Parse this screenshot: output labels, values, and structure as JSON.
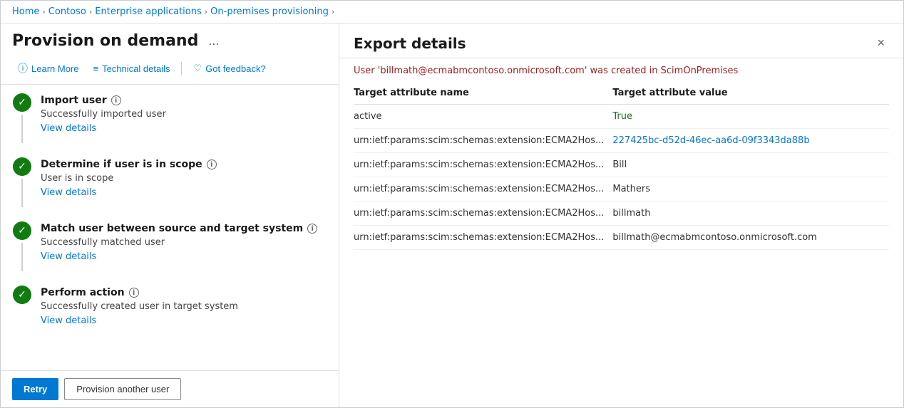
{
  "breadcrumb": {
    "items": [
      {
        "label": "Home",
        "active": true
      },
      {
        "label": "Contoso",
        "active": true
      },
      {
        "label": "Enterprise applications",
        "active": true
      },
      {
        "label": "On-premises provisioning",
        "active": true
      }
    ]
  },
  "left": {
    "title": "Provision on demand",
    "ellipsis": "...",
    "toolbar": {
      "learn_more": "Learn More",
      "technical_details": "Technical details",
      "got_feedback": "Got feedback?"
    },
    "steps": [
      {
        "title": "Import user",
        "desc": "Successfully imported user",
        "link": "View details"
      },
      {
        "title": "Determine if user is in scope",
        "desc": "User is in scope",
        "link": "View details"
      },
      {
        "title": "Match user between source and target system",
        "desc": "Successfully matched user",
        "link": "View details"
      },
      {
        "title": "Perform action",
        "desc": "Successfully created user in target system",
        "link": "View details"
      }
    ],
    "actions": {
      "retry": "Retry",
      "provision_another": "Provision another user"
    }
  },
  "right": {
    "title": "Export details",
    "close_label": "×",
    "subtitle_before": "User '",
    "subtitle_email": "billmath@ecmabmcontoso.onmicrosoft.com",
    "subtitle_after": "' was created in ScimOnPremises",
    "table": {
      "col1": "Target attribute name",
      "col2": "Target attribute value",
      "rows": [
        {
          "attr": "active",
          "value": "True",
          "type": "bool"
        },
        {
          "attr": "urn:ietf:params:scim:schemas:extension:ECMA2Hos...",
          "value": "227425bc-d52d-46ec-aa6d-09f3343da88b",
          "type": "hash"
        },
        {
          "attr": "urn:ietf:params:scim:schemas:extension:ECMA2Hos...",
          "value": "Bill",
          "type": "text"
        },
        {
          "attr": "urn:ietf:params:scim:schemas:extension:ECMA2Hos...",
          "value": "Mathers",
          "type": "text"
        },
        {
          "attr": "urn:ietf:params:scim:schemas:extension:ECMA2Hos...",
          "value": "billmath",
          "type": "text"
        },
        {
          "attr": "urn:ietf:params:scim:schemas:extension:ECMA2Hos...",
          "value": "billmath@ecmabmcontoso.onmicrosoft.com",
          "type": "text"
        }
      ]
    }
  },
  "icons": {
    "check": "✓",
    "info": "i",
    "learn_more_icon": "ⓘ",
    "technical_icon": "☰",
    "feedback_icon": "♡",
    "chevron": "›"
  }
}
